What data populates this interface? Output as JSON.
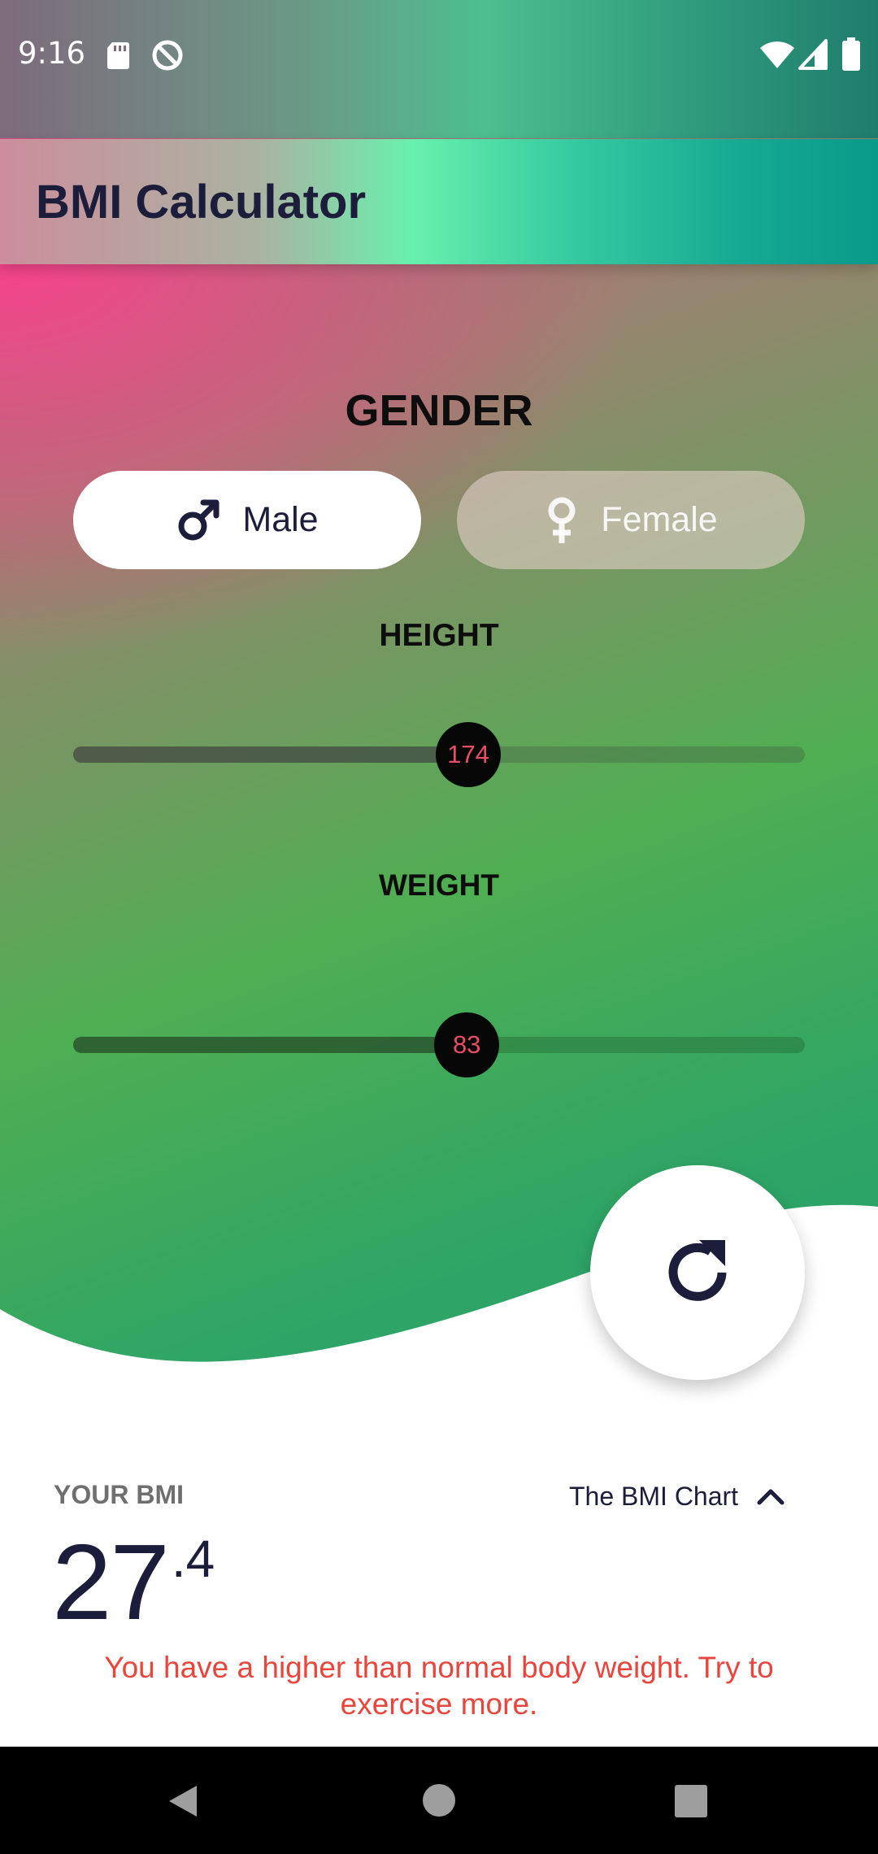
{
  "status_bar": {
    "time": "9:16",
    "left_icons": [
      "sd-card-icon",
      "do-not-disturb-icon"
    ],
    "right_icons": [
      "wifi-icon",
      "cell-signal-icon",
      "battery-icon"
    ]
  },
  "app_bar": {
    "title": "BMI Calculator"
  },
  "gender": {
    "label": "GENDER",
    "options": [
      {
        "label": "Male",
        "icon": "male-symbol-icon",
        "selected": true
      },
      {
        "label": "Female",
        "icon": "female-symbol-icon",
        "selected": false
      }
    ]
  },
  "height": {
    "label": "HEIGHT",
    "value": "174",
    "fraction": 0.54
  },
  "weight": {
    "label": "WEIGHT",
    "value": "83",
    "fraction": 0.538
  },
  "reset": {
    "icon": "refresh-icon"
  },
  "result": {
    "label": "YOUR BMI",
    "chart_toggle_label": "The BMI Chart",
    "chart_toggle_icon": "chevron-up-icon",
    "bmi_integer": "27",
    "bmi_decimal": ".4",
    "message": "You have a higher than normal body weight. Try to exercise more."
  },
  "nav_bar": {
    "buttons": [
      "back-icon",
      "home-icon",
      "recents-icon"
    ]
  },
  "colors": {
    "accent_pink": "#ff3e8c",
    "accent_green": "#4caf50",
    "title_color": "#1b1d3a",
    "warning_red": "#e8453c"
  }
}
